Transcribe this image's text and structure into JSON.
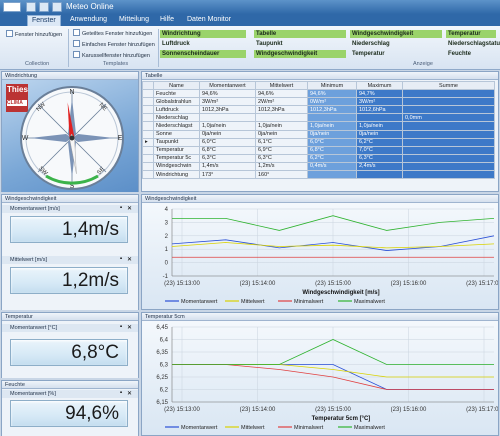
{
  "window": {
    "title": "Meteo Online"
  },
  "menu": {
    "tabs": [
      {
        "label": "Fenster"
      },
      {
        "label": "Anwendung"
      },
      {
        "label": "Mitteilung"
      },
      {
        "label": "Hilfe"
      },
      {
        "label": "Daten Monitor"
      }
    ]
  },
  "ribbon": {
    "add_window": "Fenster hinzufügen",
    "split_window": "Geteiltes Fenster hinzufügen",
    "simple_window": "Einfaches Fenster hinzufügen",
    "carousel_window": "Karussellfenster hinzufügen",
    "group_collection": "Collection",
    "group_templates": "Templates",
    "group_display": "Anzeige",
    "items": [
      [
        "Windrichtung",
        "Tabelle",
        "Windgeschwindigkeit",
        "Temperatur"
      ],
      [
        "Luftdruck",
        "Taupunkt",
        "Niederschlag",
        "Niederschlagstatus"
      ],
      [
        "Sonnenscheindauer",
        "Windgeschwindigkeit",
        "Temperatur",
        "Feuchte"
      ]
    ]
  },
  "compass": {
    "title": "Windrichtung",
    "brand": "Thies",
    "brand_sub": "CLIMA",
    "labels": [
      "N",
      "E",
      "S",
      "W",
      "NE",
      "SE",
      "SW",
      "NW"
    ],
    "direction_deg": 173
  },
  "windspeed": {
    "title": "Windgeschwindigkeit",
    "current_label": "Momentanwert [m/s]",
    "current": "1,4m/s",
    "mean_label": "Mittelwert [m/s]",
    "mean": "1,2m/s"
  },
  "temperature": {
    "title": "Temperatur",
    "current_label": "Momentanwert [°C]",
    "current": "6,8°C"
  },
  "humidity": {
    "title": "Feuchte",
    "current_label": "Momentanwert [%]",
    "current": "94,6%"
  },
  "table": {
    "title": "Tabelle",
    "headers": [
      "Name",
      "Momentanwert",
      "Mittelwert",
      "Minimum",
      "Maximum",
      "Summe"
    ],
    "rows": [
      [
        "Feuchte",
        "94,6%",
        "94,6%",
        "94,6%",
        "94,7%",
        ""
      ],
      [
        "Globalstrahlun",
        "3W/m²",
        "2W/m²",
        "0W/m²",
        "3W/m²",
        ""
      ],
      [
        "Luftdruck",
        "1012,3hPa",
        "1012,3hPa",
        "1012,3hPa",
        "1012,6hPa",
        ""
      ],
      [
        "Niederschlag",
        "",
        "",
        "",
        "",
        "0,0mm"
      ],
      [
        "Niederschlagst",
        "1,0ja/nein",
        "1,0ja/nein",
        "1,0ja/nein",
        "1,0ja/nein",
        ""
      ],
      [
        "Sonne",
        "0ja/nein",
        "0ja/nein",
        "0ja/nein",
        "0ja/nein",
        ""
      ],
      [
        "Taupunkt",
        "6,0°C",
        "6,1°C",
        "6,0°C",
        "6,2°C",
        ""
      ],
      [
        "Temperatur",
        "6,8°C",
        "6,9°C",
        "6,8°C",
        "7,0°C",
        ""
      ],
      [
        "Temperatur 5c",
        "6,3°C",
        "6,3°C",
        "6,2°C",
        "6,3°C",
        ""
      ],
      [
        "Windgeschwin",
        "1,4m/s",
        "1,2m/s",
        "0,4m/s",
        "2,4m/s",
        ""
      ],
      [
        "Windrichtung",
        "173°",
        "160°",
        "",
        "",
        ""
      ]
    ]
  },
  "chart_data": [
    {
      "type": "line",
      "title": "Windgeschwindigkeit",
      "xlabel": "Windgeschwindigkeit [m/s]",
      "categories": [
        "(23) 15:13:00",
        "(23) 15:14:00",
        "(23) 15:15:00",
        "(23) 15:16:00",
        "(23) 15:17:00"
      ],
      "yticks": [
        "4",
        "3",
        "2",
        "1",
        "0",
        "-1"
      ],
      "ylim": [
        -1,
        4
      ],
      "x": [
        0,
        1,
        2,
        3,
        4,
        5,
        6
      ],
      "series": [
        {
          "name": "Momentanwert",
          "color": "#2a4fd6",
          "values": [
            1.4,
            1.7,
            1.1,
            1.5,
            0.9,
            1.2,
            2.0
          ]
        },
        {
          "name": "Mittelwert",
          "color": "#d9d200",
          "values": [
            1.2,
            1.5,
            1.2,
            1.3,
            1.1,
            1.2,
            1.4
          ]
        },
        {
          "name": "Minimalwert",
          "color": "#e04040",
          "values": [
            0.4,
            0.4,
            0.4,
            0.4,
            0.4,
            0.4,
            0.4
          ]
        },
        {
          "name": "Maximalwert",
          "color": "#2fb32f",
          "values": [
            3.3,
            3.3,
            2.4,
            3.5,
            2.4,
            3.0,
            3.3
          ]
        }
      ]
    },
    {
      "type": "line",
      "title": "Temperatur 5cm",
      "xlabel": "Temperatur 5cm [°C]",
      "categories": [
        "(23) 15:13:00",
        "(23) 15:14:00",
        "(23) 15:15:00",
        "(23) 15:16:00",
        "(23) 15:17:00"
      ],
      "yticks": [
        "6,45",
        "6,4",
        "6,35",
        "6,3",
        "6,25",
        "6,2",
        "6,15"
      ],
      "ylim": [
        6.15,
        6.45
      ],
      "x": [
        0,
        1,
        2,
        3,
        4,
        5,
        6
      ],
      "series": [
        {
          "name": "Momentanwert",
          "color": "#2a4fd6",
          "values": [
            6.3,
            6.3,
            6.3,
            6.3,
            6.2,
            6.2,
            6.2
          ]
        },
        {
          "name": "Mittelwert",
          "color": "#d9d200",
          "values": [
            6.3,
            6.3,
            6.3,
            6.28,
            6.25,
            6.25,
            6.25
          ]
        },
        {
          "name": "Minimalwert",
          "color": "#e04040",
          "values": [
            6.3,
            6.3,
            6.28,
            6.25,
            6.2,
            6.2,
            6.2
          ]
        },
        {
          "name": "Maximalwert",
          "color": "#2fb32f",
          "values": [
            6.3,
            6.3,
            6.3,
            6.4,
            6.3,
            6.3,
            6.3
          ]
        }
      ]
    }
  ]
}
